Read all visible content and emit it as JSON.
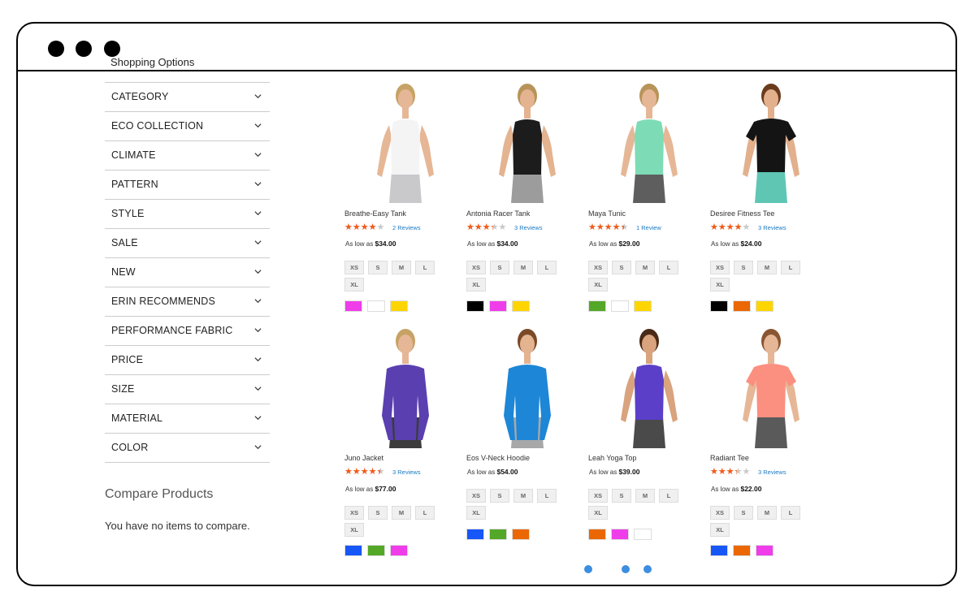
{
  "window": {
    "controls": [
      "close",
      "minimize",
      "maximize"
    ]
  },
  "sidebar": {
    "title": "Shopping Options",
    "filters": [
      "CATEGORY",
      "ECO COLLECTION",
      "CLIMATE",
      "PATTERN",
      "STYLE",
      "SALE",
      "NEW",
      "ERIN RECOMMENDS",
      "PERFORMANCE FABRIC",
      "PRICE",
      "SIZE",
      "MATERIAL",
      "COLOR"
    ],
    "compare_title": "Compare Products",
    "compare_empty": "You have no items to compare."
  },
  "price_prefix": "As low as",
  "sizes": [
    "XS",
    "S",
    "M",
    "L",
    "XL"
  ],
  "products": [
    {
      "name": "Breathe-Easy Tank",
      "rating": 0.7,
      "reviews": "2  Reviews",
      "price": "$34.00",
      "swatches": [
        "#ef3dea",
        "#ffffff",
        "#ffd500"
      ],
      "top_color": "#f4f4f4",
      "bottom_color": "#c9c9cc",
      "hair": "#c7a266",
      "skin": "#e6b796"
    },
    {
      "name": "Antonia Racer Tank",
      "rating": 0.6,
      "reviews": "3  Reviews",
      "price": "$34.00",
      "swatches": [
        "#000000",
        "#ef3dea",
        "#ffd500"
      ],
      "top_color": "#1c1c1c",
      "bottom_color": "#9c9c9c",
      "hair": "#b8935a",
      "skin": "#e4b390"
    },
    {
      "name": "Maya Tunic",
      "rating": 0.8,
      "reviews": "1  Review",
      "price": "$29.00",
      "swatches": [
        "#53a828",
        "#ffffff",
        "#ffd500"
      ],
      "top_color": "#7ddcb5",
      "bottom_color": "#5e5e5e",
      "hair": "#b8935a",
      "skin": "#e6b796"
    },
    {
      "name": "Desiree Fitness Tee",
      "rating": 0.7,
      "reviews": "3  Reviews",
      "price": "$24.00",
      "swatches": [
        "#000000",
        "#eb6703",
        "#ffd500"
      ],
      "top_color": "#141414",
      "bottom_color": "#5fc6b4",
      "hair": "#6b3b1e",
      "skin": "#e2b08c"
    },
    {
      "name": "Juno Jacket",
      "rating": 0.8,
      "reviews": "3  Reviews",
      "price": "$77.00",
      "swatches": [
        "#1857f7",
        "#53a828",
        "#ef3dea"
      ],
      "top_color": "#5a3fb0",
      "bottom_color": "#3c3c3c",
      "hair": "#c7a266",
      "skin": "#e6b796"
    },
    {
      "name": "Eos V-Neck Hoodie",
      "rating": null,
      "reviews": "",
      "price": "$54.00",
      "swatches": [
        "#1857f7",
        "#53a828",
        "#eb6703"
      ],
      "top_color": "#1d86d6",
      "bottom_color": "#a8a8a8",
      "hair": "#7a4a28",
      "skin": "#e4b390"
    },
    {
      "name": "Leah Yoga Top",
      "rating": null,
      "reviews": "",
      "price": "$39.00",
      "swatches": [
        "#eb6703",
        "#ef3dea",
        "#ffffff"
      ],
      "top_color": "#5b3fc9",
      "bottom_color": "#4a4a4a",
      "hair": "#4a2a16",
      "skin": "#d9a37e"
    },
    {
      "name": "Radiant Tee",
      "rating": 0.6,
      "reviews": "3  Reviews",
      "price": "$22.00",
      "swatches": [
        "#1857f7",
        "#eb6703",
        "#ef3dea"
      ],
      "top_color": "#fb8f80",
      "bottom_color": "#5a5a5a",
      "hair": "#8a5532",
      "skin": "#e6b796"
    }
  ],
  "pager": {
    "page_count": 3,
    "active_index": 0
  }
}
